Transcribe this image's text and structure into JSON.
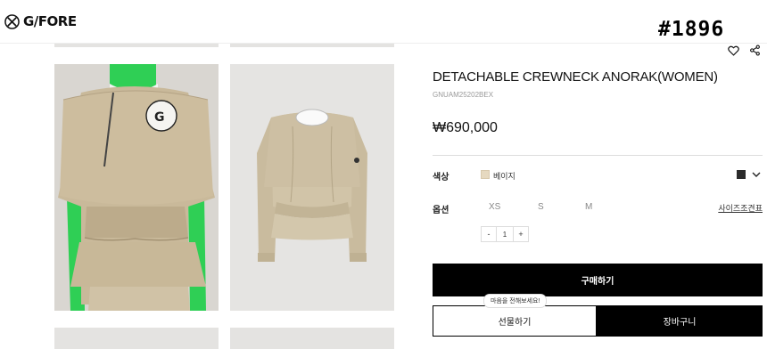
{
  "header": {
    "brand": "G/FORE",
    "page_id": "#1896"
  },
  "product": {
    "title": "DETACHABLE CREWNECK ANORAK(WOMEN)",
    "code": "GNUAM25202BEX",
    "price": "₩690,000",
    "color_label": "색상",
    "selected_color": "베이지",
    "colors": {
      "beige": "#e6d9c0",
      "charcoal": "#2b2b2b"
    },
    "option_label": "옵션",
    "sizes": [
      "XS",
      "S",
      "M"
    ],
    "size_guide": "사이즈조견표",
    "quantity": "1",
    "qty_minus": "-",
    "qty_plus": "+"
  },
  "actions": {
    "buy": "구매하기",
    "gift": "선물하기",
    "cart": "장바구니",
    "gift_tooltip": "마음을 전해보세요!"
  },
  "icons": [
    "logo-icon",
    "heart-icon",
    "share-icon",
    "chevron-down-icon"
  ]
}
